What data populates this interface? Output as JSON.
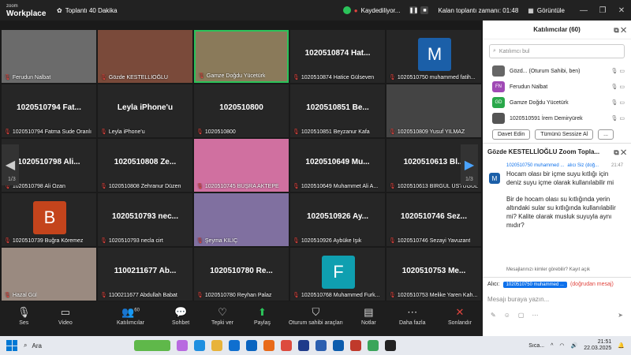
{
  "titlebar": {
    "logo_top": "zoom",
    "logo_bottom": "Workplace",
    "meeting": "Toplantı 40 Dakika",
    "recording": "Kaydediliyor...",
    "remaining": "Kalan toplantı zamanı: 01:48",
    "view": "Görüntüle"
  },
  "tiles": [
    {
      "big": "",
      "tag": "Ferudun Nalbat",
      "photo": "#6b6b6b"
    },
    {
      "big": "",
      "tag": "Gözde KESTELLİOĞLU",
      "photo": "#7a4a3a"
    },
    {
      "big": "",
      "tag": "Gamze Doğdu Yücetürk",
      "photo": "#8a7a5a"
    },
    {
      "big": "1020510874 Hat...",
      "tag": "1020510874 Hatice Gülseven"
    },
    {
      "big": "",
      "tag": "1020510750 muhammed fatih...",
      "avatar": "M",
      "color": "#1b5fa8"
    },
    {
      "big": "1020510794 Fat...",
      "tag": "1020510794 Fatma Sude Oranlı"
    },
    {
      "big": "Leyla iPhone'u",
      "tag": "Leyla iPhone'u"
    },
    {
      "big": "1020510800",
      "tag": "1020510800"
    },
    {
      "big": "1020510851 Be...",
      "tag": "1020510851 Beyzanur Kafa"
    },
    {
      "big": "",
      "tag": "1020510809 Yusuf YILMAZ",
      "photo": "#444"
    },
    {
      "big": "1020510798 Ali...",
      "tag": "1020510798 Ali Ozan"
    },
    {
      "big": "1020510808 Ze...",
      "tag": "1020510808 Zehranur Düzen"
    },
    {
      "big": "",
      "tag": "1020510745 BÜŞRA AKTEPE",
      "photo": "#d070a0"
    },
    {
      "big": "1020510649 Mu...",
      "tag": "1020510649 Muhammet Ali A..."
    },
    {
      "big": "1020510613 Bİ...",
      "tag": "1020510613 BİRGÜL ÜSTÜGÜL"
    },
    {
      "big": "",
      "tag": "1020510739 Buğra Köremez",
      "avatar": "B",
      "color": "#c4441c"
    },
    {
      "big": "1020510793 nec...",
      "tag": "1020510793 necla cirt"
    },
    {
      "big": "",
      "tag": "Şeyma KILIÇ",
      "photo": "#8070a0"
    },
    {
      "big": "1020510926 Ay...",
      "tag": "1020510926 Aybüke Işık"
    },
    {
      "big": "1020510746 Sez...",
      "tag": "1020510746 Sezayi Yavuzant"
    },
    {
      "big": "",
      "tag": "Hazal Gül",
      "photo": "#9a8a80"
    },
    {
      "big": "1100211677 Ab...",
      "tag": "1100211677 Abdullah Babat"
    },
    {
      "big": "1020510780 Re...",
      "tag": "1020510780 Reyhan Palaz"
    },
    {
      "big": "",
      "tag": "1020510768 Muhammed Furk...",
      "avatar": "F",
      "color": "#0f9fb0"
    },
    {
      "big": "1020510753 Me...",
      "tag": "1020510753 Melike Yaren Kah..."
    }
  ],
  "pages": {
    "left": "1/3",
    "right": "1/3"
  },
  "participants": {
    "title": "Katılımcılar (60)",
    "search_placeholder": "Katılımcı bul",
    "list": [
      {
        "initials": "",
        "name": "Gözd... (Oturum Sahibi, ben)",
        "color": "#666"
      },
      {
        "initials": "FN",
        "name": "Ferudun Nalbat",
        "color": "#a04ab5"
      },
      {
        "initials": "GD",
        "name": "Gamze Doğdu Yücetürk",
        "color": "#2aa84a"
      },
      {
        "initials": "",
        "name": "1020510591 İrem Demiryürek",
        "color": "#555"
      }
    ],
    "invite": "Davet Edin",
    "mute_all": "Tümünü Sessize Al",
    "more": "..."
  },
  "chat": {
    "title": "Gözde KESTELLİOĞLU Zoom Topla...",
    "from": "1020510750 muhammed ...",
    "to": "alıcı Siz (doğ...",
    "time": "21:47",
    "msg1": "Hocam olası bir içme suyu kıtlığı için deniz suyu içme olarak kullanılabilir mi",
    "msg2": "Bir de hocam olası su kıtlığında yerin altındaki sular su kıtlığında kullanılabilir mi? Kalite olarak musluk suyuyla aynı mıdır?",
    "visibility": "Mesajlarınızı kimler görebilir? Kayıt açık",
    "recipient_label": "Alıcı:",
    "recipient": "1020510750 muhammed ...",
    "recipient_note": "(doğrudan mesaj)",
    "input_placeholder": "Mesajı buraya yazın..."
  },
  "toolbar": {
    "audio": "Ses",
    "video": "Video",
    "participants": "Katılımcılar",
    "participants_count": "60",
    "chat": "Sohbet",
    "react": "Tepki ver",
    "share": "Paylaş",
    "host_tools": "Oturum sahibi araçları",
    "notes": "Notlar",
    "more": "Daha fazla",
    "end": "Sonlandır"
  },
  "taskbar": {
    "search": "Ara",
    "weather": "Sıca...",
    "time": "21:51",
    "date": "22.03.2025"
  }
}
